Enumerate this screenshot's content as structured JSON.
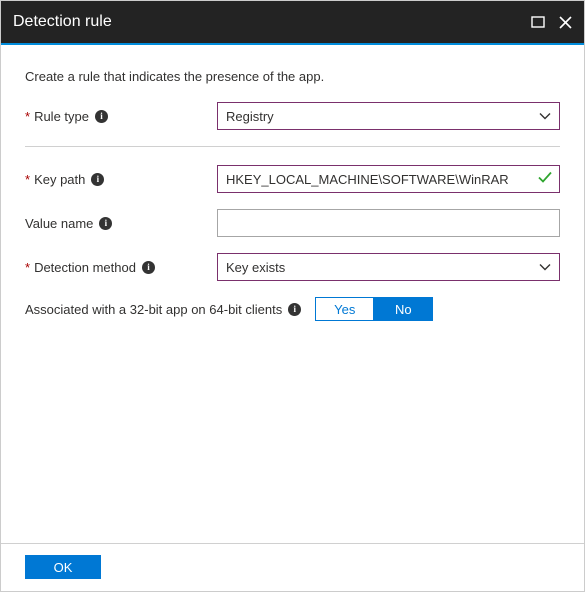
{
  "header": {
    "title": "Detection rule"
  },
  "intro": "Create a rule that indicates the presence of the app.",
  "fields": {
    "rule_type": {
      "label": "Rule type",
      "value": "Registry"
    },
    "key_path": {
      "label": "Key path",
      "value": "HKEY_LOCAL_MACHINE\\SOFTWARE\\WinRAR"
    },
    "value_name": {
      "label": "Value name",
      "value": ""
    },
    "detection_method": {
      "label": "Detection method",
      "value": "Key exists"
    },
    "assoc": {
      "label": "Associated with a 32-bit app on 64-bit clients",
      "yes": "Yes",
      "no": "No",
      "selected": "No"
    }
  },
  "footer": {
    "ok": "OK"
  }
}
